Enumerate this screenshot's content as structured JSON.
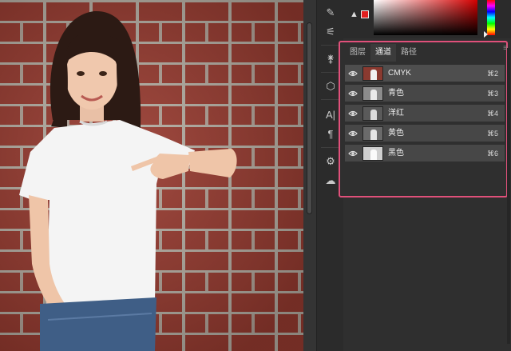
{
  "canvas": {
    "subject": "child-pointing-at-tshirt-photo"
  },
  "colors": {
    "accent_highlight": "#e0507a",
    "foreground_swatch": "#e01e1e",
    "panel_bg": "#2f2f2f",
    "row_bg": "#474747"
  },
  "tool_column": {
    "items": [
      {
        "icon": "brush-settings-icon",
        "glyph": "✎"
      },
      {
        "icon": "adjust-sliders-icon",
        "glyph": "⚟"
      },
      {
        "icon": "clone-source-icon",
        "glyph": "⚵"
      },
      {
        "icon": "3d-cube-icon",
        "glyph": "⬡"
      },
      {
        "icon": "character-panel-icon",
        "glyph": "A|"
      },
      {
        "icon": "paragraph-panel-icon",
        "glyph": "¶"
      },
      {
        "icon": "properties-icon",
        "glyph": "⚙"
      },
      {
        "icon": "creative-cloud-icon",
        "glyph": "☁"
      }
    ]
  },
  "color_panel": {
    "warning_glyph": "▲"
  },
  "channels_panel": {
    "tabs": [
      {
        "label": "图层",
        "active": false
      },
      {
        "label": "通道",
        "active": true
      },
      {
        "label": "路径",
        "active": false
      }
    ],
    "menu_glyph": "≡",
    "channels": [
      {
        "name": "CMYK",
        "shortcut": "⌘2",
        "thumb": "composite"
      },
      {
        "name": "青色",
        "shortcut": "⌘3",
        "thumb": "gray"
      },
      {
        "name": "洋红",
        "shortcut": "⌘4",
        "thumb": "gray"
      },
      {
        "name": "黄色",
        "shortcut": "⌘5",
        "thumb": "gray"
      },
      {
        "name": "黑色",
        "shortcut": "⌘6",
        "thumb": "light"
      }
    ]
  }
}
